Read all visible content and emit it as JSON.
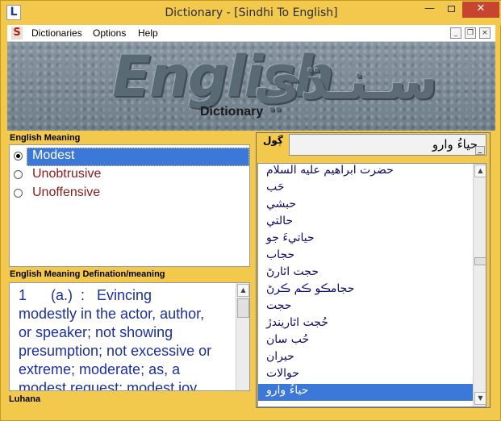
{
  "window": {
    "title": "Dictionary - [Sindhi To English]",
    "app_icon_letter": "L",
    "buttons": {
      "minimize": "—",
      "maximize": "",
      "close": "✕"
    }
  },
  "menubar": {
    "icon_letter": "S",
    "items": [
      "Dictionaries",
      "Options",
      "Help"
    ],
    "mdi_buttons": {
      "minimize": "_",
      "restore": "❐",
      "close": "×"
    }
  },
  "banner": {
    "english": "English",
    "sindhi": "سـنـڌي",
    "subtitle": "Dictionary"
  },
  "meaning_panel": {
    "label": "English Meaning",
    "items": [
      {
        "label": "Modest",
        "selected": true
      },
      {
        "label": "Unobtrusive",
        "selected": false
      },
      {
        "label": "Unoffensive",
        "selected": false
      }
    ]
  },
  "definition_panel": {
    "label": "English Meaning Defination/meaning",
    "text": "1      (a.)  :   Evincing\nmodestly in the actor, author,\nor speaker; not showing\npresumption; not excessive or\nextreme; moderate; as, a\nmodest request; modest joy"
  },
  "status": {
    "label": "Luhana"
  },
  "search": {
    "label": "ڳول",
    "value": "حياءُ وارو",
    "button": "_"
  },
  "word_list": {
    "items": [
      "حضرت ابراهيم عليه السلام",
      "حَب",
      "حبشي",
      "حالتي",
      "حياتيءَ جو",
      "حجاب",
      "حجت اٿارڻ",
      "حجامڪو ڪم ڪرڻ",
      "حجت",
      "حُجت اٿاريندڙ",
      "حُب سان",
      "حيران",
      "حوالات",
      "حياءُ وارو"
    ],
    "selected_index": 13
  },
  "colors": {
    "frame": "#f2c94c",
    "selection": "#3c78d8",
    "meaning_text": "#8b1a1a",
    "definition_text": "#1a2fa0",
    "close_button": "#c8452d"
  }
}
